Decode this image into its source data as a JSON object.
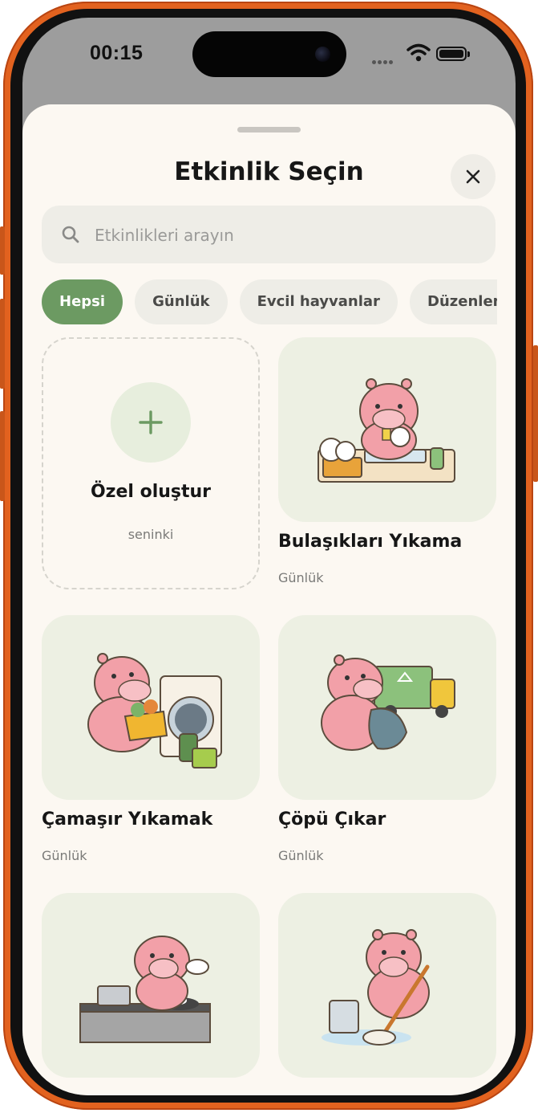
{
  "status": {
    "time": "00:15"
  },
  "sheet": {
    "title": "Etkinlik Seçin",
    "close_icon": "close-icon",
    "search": {
      "placeholder": "Etkinlikleri arayın"
    },
    "chips": [
      "Hepsi",
      "Günlük",
      "Evcil hayvanlar",
      "Düzenleme"
    ],
    "active_chip": "Hepsi",
    "custom": {
      "title": "Özel oluştur",
      "subtitle": "seninki"
    },
    "cards": [
      {
        "name": "Bulaşıkları Yıkama",
        "category": "Günlük",
        "icon": "hippo-washing-dishes"
      },
      {
        "name": "Çamaşır Yıkamak",
        "category": "Günlük",
        "icon": "hippo-laundry"
      },
      {
        "name": "Çöpü Çıkar",
        "category": "Günlük",
        "icon": "hippo-trash"
      },
      {
        "name": "",
        "category": "",
        "icon": "hippo-cooking"
      },
      {
        "name": "",
        "category": "",
        "icon": "hippo-mopping"
      }
    ]
  },
  "colors": {
    "frame": "#e2621f",
    "accent": "#6c9a62",
    "sheet_bg": "#fcf8f2",
    "tile_bg": "#edf0e3",
    "hippo": "#f2a0a8"
  }
}
